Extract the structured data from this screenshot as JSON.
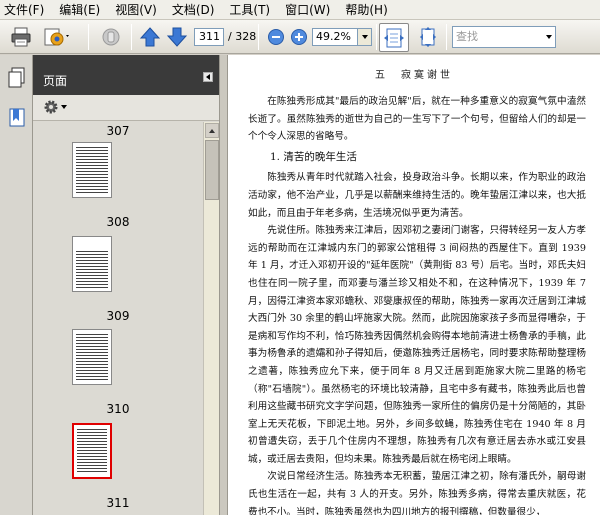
{
  "menu": [
    "文件(F)",
    "编辑(E)",
    "视图(V)",
    "文档(D)",
    "工具(T)",
    "窗口(W)",
    "帮助(H)"
  ],
  "toolbar": {
    "current_page": "311",
    "page_total": "/ 328",
    "zoom": "49.2%",
    "search_placeholder": "查找"
  },
  "pages_panel": {
    "title": "页面",
    "thumbnails": [
      {
        "label": "307"
      },
      {
        "label": "308"
      },
      {
        "label": "309"
      },
      {
        "label": "310"
      },
      {
        "label": "311",
        "selected": true
      }
    ]
  },
  "document": {
    "header": "五　寂寞谢世",
    "paragraphs_before": [
      "在陈独秀形成其\"最后的政治见解\"后，就在一种多重意义的寂寞气氛中溘然长逝了。虽然陈独秀的逝世为自己的一生写下了一个句号，但留给人们的却是一个个令人深思的省略号。"
    ],
    "section_title": "1. 清苦的晚年生活",
    "paragraphs_after": [
      "陈独秀从青年时代就踏入社会，投身政治斗争。长期以来，作为职业的政治活动家，他不治产业，几乎是以薪酬来维持生活的。晚年蛰居江津以来，也大抵如此，而且由于年老多病，生活境况似乎更为清苦。",
      "先说住所。陈独秀来江津后，因邓初之妻闭门谢客，只得转经另一友人方孝远的帮助而在江津城内东门的郭家公馆租得 3 间闷热的西屋住下。直到 1939 年 1 月，才迁入邓初开设的\"延年医院\"（黄荆街 83 号）后宅。当时，邓氏夫妇也住在同一院子里，而邓妻与潘兰珍又相处不和，在这种情况下，1939 年 7 月，因得江津资本家邓蟾秋、邓燮康叔侄的帮助，陈独秀一家再次迁居到江津城大西门外 30 余里的鹤山坪施家大院。然而，此院因施家孩子多而显得嘈杂，于是病和写作均不利，恰巧陈独秀因偶然机会购得本地前清进士杨鲁承的手稿，此事为杨鲁承的遗孀和孙子得知后，便邀陈独秀迁居杨宅，同时要求陈帮助整理杨之遗著，陈独秀应允下来，便于同年 8 月又迁居到距施家大院二里路的杨宅（称\"石墙院\"）。虽然杨宅的环境比较清静，且宅中多有藏书，陈独秀此后也曾利用这些藏书研究文字学问题，但陈独秀一家所住的偏房仍是十分简陋的，其卧室上无天花板，下即泥土地。另外，乡间多蚊蝇，陈独秀住宅在 1940 年 8 月初曾遭失窃，丢于几个住房内不理想，陈独秀有几次有意迁居去赤水或江安县城，或迁居去贵阳，但均未果。陈独秀最后就在杨宅闭上眼睛。",
      "次说日常经济生活。陈独秀本无积蓄，蛰居江津之初，除有潘氏外，嗣母谢氏也生活在一起，共有 3 人的开支。另外，陈独秀多病，得常去重庆就医，花费也不小。当时，陈独秀虽然也为四川地方的报刊撰稿，但数量很少，"
    ]
  }
}
